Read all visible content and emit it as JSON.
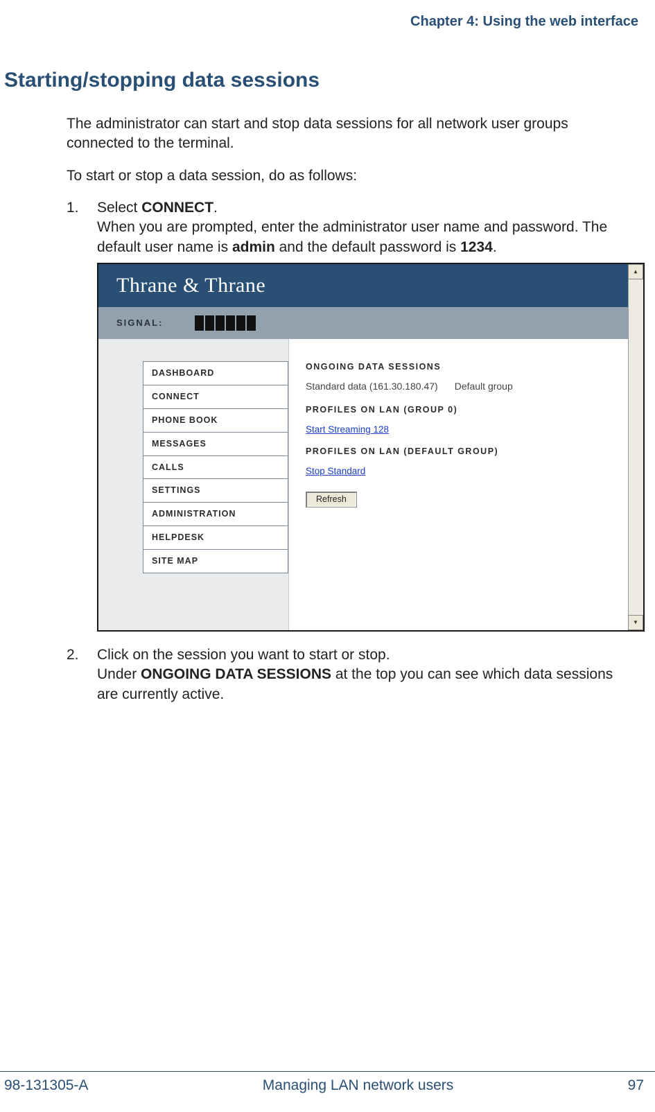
{
  "header": {
    "chapter": "Chapter 4: Using the web interface"
  },
  "section": {
    "title": "Starting/stopping data sessions"
  },
  "body": {
    "intro": "The administrator can start and stop data sessions for all network user groups connected to the terminal.",
    "lead": "To start or stop a data session, do as follows:"
  },
  "steps": {
    "s1_num": "1.",
    "s1_a": "Select ",
    "s1_b": "CONNECT",
    "s1_c": ".",
    "s1_follow_a": "When you are prompted, enter the administrator user name and password. The default user name is ",
    "s1_follow_b": "admin",
    "s1_follow_c": " and the default password is ",
    "s1_follow_d": "1234",
    "s1_follow_e": ".",
    "s2_num": "2.",
    "s2_a": "Click on the session you want to start or stop.",
    "s2_b": "Under ",
    "s2_c": "ONGOING DATA SESSIONS",
    "s2_d": " at the top you can see which data sessions are currently active."
  },
  "ui": {
    "brand": "Thrane & Thrane",
    "signal_label": "SIGNAL:",
    "nav": {
      "0": "DASHBOARD",
      "1": "CONNECT",
      "2": "PHONE BOOK",
      "3": "MESSAGES",
      "4": "CALLS",
      "5": "SETTINGS",
      "6": "ADMINISTRATION",
      "7": "HELPDESK",
      "8": "SITE MAP"
    },
    "content": {
      "h1": "ONGOING DATA SESSIONS",
      "std_data": "Standard data (161.30.180.47)",
      "std_group": "Default group",
      "h2": "PROFILES ON LAN (GROUP 0)",
      "link1": "Start Streaming 128",
      "h3": "PROFILES ON LAN (DEFAULT GROUP)",
      "link2": "Stop Standard",
      "refresh": "Refresh"
    },
    "scroll_up": "▴",
    "scroll_down": "▾"
  },
  "footer": {
    "doc": "98-131305-A",
    "title": "Managing LAN network users",
    "page": "97"
  }
}
